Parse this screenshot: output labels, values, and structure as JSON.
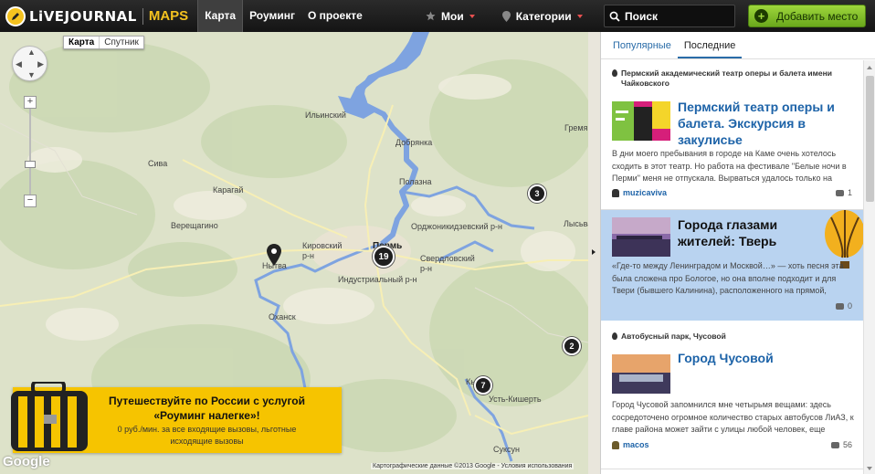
{
  "header": {
    "logo_lj": "LiVEJOURNAL",
    "logo_maps": "MAPS",
    "nav": [
      "Карта",
      "Роуминг",
      "О проекте"
    ],
    "menus": [
      {
        "label": "Мои",
        "icon": "star-icon"
      },
      {
        "label": "Категории",
        "icon": "pin-icon"
      }
    ],
    "search_placeholder": "Поиск",
    "add_button": "Добавить место"
  },
  "map": {
    "map_type": [
      "Карта",
      "Спутник"
    ],
    "places": [
      "Ильинский",
      "Сива",
      "Карагай",
      "Верещагино",
      "Нытва",
      "Кировский р-н",
      "Пермь",
      "Индустриальный р-н",
      "Свердловский р-н",
      "Орджоникидзевский р-н",
      "Добрянка",
      "Полазна",
      "Оханск",
      "Лысьва",
      "Кын",
      "Усть-Кишерть",
      "Суксун",
      "Гремячинск"
    ],
    "clusters": [
      "19",
      "3",
      "2",
      "7"
    ],
    "copyright": "Картографические данные ©2013 Google - Условия использования",
    "google": "Google"
  },
  "banner": {
    "title_line1": "Путешествуйте по России с услугой",
    "title_line2": "«Роуминг налегке»!",
    "subtitle": "0 руб./мин. за все входящие вызовы, льготные исходящие вызовы"
  },
  "sidebar": {
    "tabs": [
      "Популярные",
      "Последние"
    ],
    "active_tab": "Последние",
    "posts": [
      {
        "location": "Пермский академический театр оперы и балета имени Чайковского",
        "title": "Пермский театр оперы и балета. Экскурсия в закулисье",
        "text": "В дни моего пребывания в городе на Каме очень хотелось сходить в этот театр. Но работа на фестивале \"Белые ночи в Перми\" меня не отпускала. Вырваться удалось только на",
        "author": "muzicaviva",
        "comments": "1"
      },
      {
        "location": "",
        "title": "Города глазами жителей: Тверь",
        "text": "«Где-то между Ленинградом и Москвой…» — хоть песня эта была сложена про Бологое, но она вполне подходит и для Твери (бывшего Калинина), расположенного на прямой,",
        "author": "",
        "comments": "0"
      },
      {
        "location": "Автобусный парк, Чусовой",
        "title": "Город Чусовой",
        "text": "Город Чусовой запомнился мне четырьмя вещами: здесь сосредоточено огромное количество старых автобусов ЛиАЗ, к главе района может зайти с улицы любой человек, еще",
        "author": "macos",
        "comments": "56"
      }
    ]
  },
  "colors": {
    "accent": "#1d63a8",
    "brand_yellow": "#f6c400",
    "add_green": "#7cbc24",
    "highlight": "#b9d3f0"
  }
}
